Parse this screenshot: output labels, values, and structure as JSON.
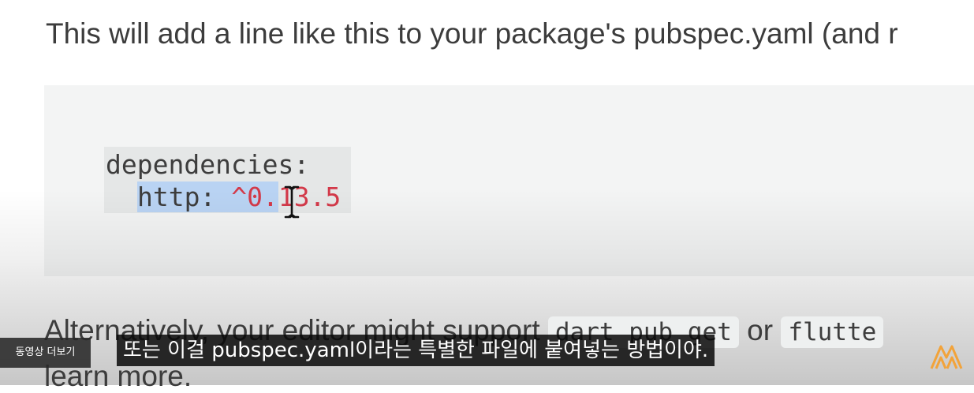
{
  "doc": {
    "intro_text": "This will add a line like this to your package's pubspec.yaml (and r",
    "code": {
      "line1": "dependencies:",
      "key": "http:",
      "version_selected": "^0.",
      "version_rest": "13.5"
    },
    "alt": {
      "text_before": "Alternatively, your editor might support ",
      "code1": "dart pub get",
      "text_mid": " or ",
      "code2": "flutte"
    },
    "learn_text": "learn more."
  },
  "overlay": {
    "more_videos_label": "동영상 더보기",
    "subtitle": "또는 이걸 pubspec.yaml이라는 특별한 파일에 붙여넣는 방법이야.",
    "logo_icon": "channel-logo-icon",
    "cursor_icon": "text-cursor-icon",
    "accent_color": "#f2a33a"
  }
}
